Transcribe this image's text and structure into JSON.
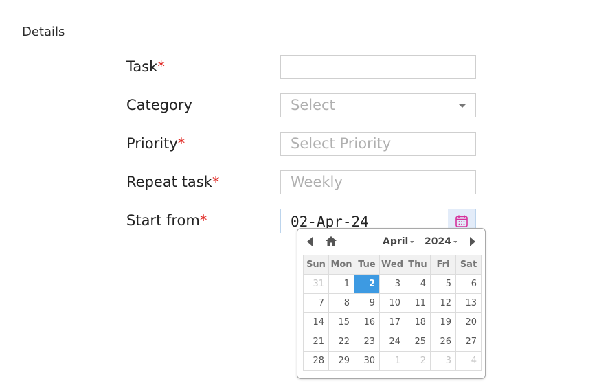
{
  "section": {
    "title": "Details"
  },
  "form": {
    "task": {
      "label": "Task",
      "required": "*",
      "value": ""
    },
    "category": {
      "label": "Category",
      "placeholder": "Select"
    },
    "priority": {
      "label": "Priority",
      "required": "*",
      "placeholder": "Select Priority"
    },
    "repeat": {
      "label": "Repeat task",
      "required": "*",
      "placeholder": "Weekly"
    },
    "start": {
      "label": "Start from",
      "required": "*",
      "value": "02-Apr-24"
    }
  },
  "calendar": {
    "month": "April",
    "year": "2024",
    "weekdays": [
      "Sun",
      "Mon",
      "Tue",
      "Wed",
      "Thu",
      "Fri",
      "Sat"
    ],
    "weeks": [
      [
        "31",
        "1",
        "2",
        "3",
        "4",
        "5",
        "6"
      ],
      [
        "7",
        "8",
        "9",
        "10",
        "11",
        "12",
        "13"
      ],
      [
        "14",
        "15",
        "16",
        "17",
        "18",
        "19",
        "20"
      ],
      [
        "21",
        "22",
        "23",
        "24",
        "25",
        "26",
        "27"
      ],
      [
        "28",
        "29",
        "30",
        "1",
        "2",
        "3",
        "4"
      ]
    ]
  },
  "colors": {
    "required": "#e0241f",
    "selected_day": "#3d9ae2",
    "calendar_icon": "#d6339c"
  },
  "icons": {
    "calendar": "calendar-icon",
    "home": "home-icon",
    "prev": "chevron-left-icon",
    "next": "chevron-right-icon"
  }
}
